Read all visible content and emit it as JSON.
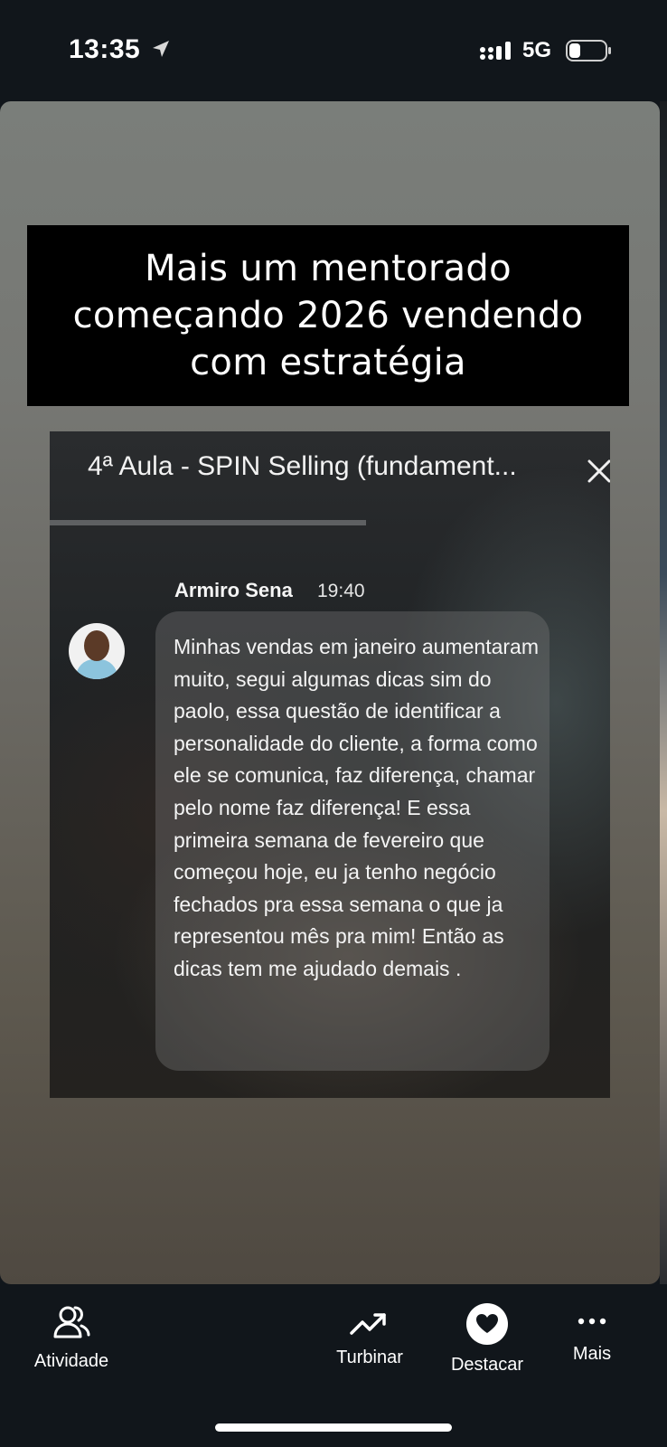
{
  "status_bar": {
    "time": "13:35",
    "network": "5G",
    "icons": [
      "location-arrow-icon",
      "signal-icon",
      "battery-icon"
    ]
  },
  "story": {
    "caption": "Mais um mentorado começando 2026 vendendo com estratégia",
    "screenshot": {
      "lesson_title": "4ª Aula - SPIN Selling (fundament...",
      "author": "Armiro Sena",
      "time": "19:40",
      "message": "Minhas vendas em janeiro aumentaram muito, segui algumas dicas sim do paolo, essa questão de identificar a personalidade do cliente, a forma como ele se comunica, faz diferença, chamar pelo nome faz diferença! E essa primeira semana de fevereiro que começou hoje, eu ja tenho negócio fechados pra essa semana o que ja representou mês pra mim! Então as dicas tem me ajudado demais ."
    }
  },
  "actions": {
    "activity": "Atividade",
    "boost": "Turbinar",
    "highlight": "Destacar",
    "more": "Mais"
  },
  "colors": {
    "background": "#11161b",
    "caption_bg": "#000000",
    "text": "#ffffff"
  }
}
